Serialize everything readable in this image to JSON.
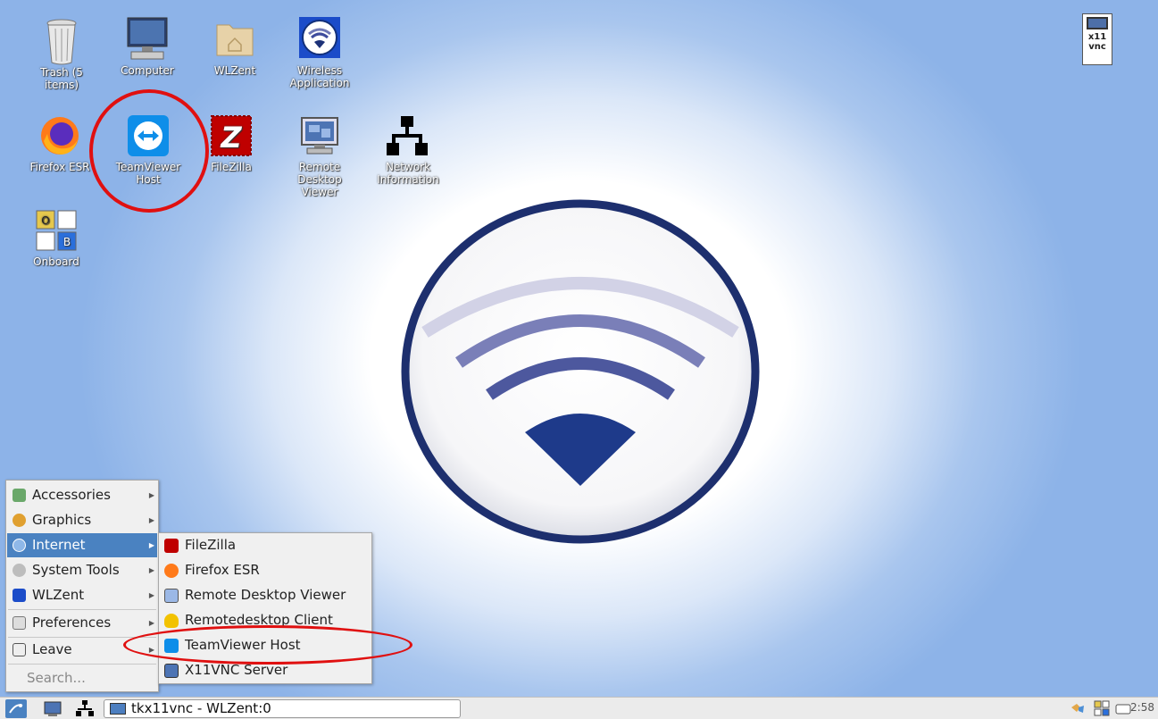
{
  "desktop": {
    "icons": [
      {
        "label": "Trash (5 items)",
        "name": "trash-icon"
      },
      {
        "label": "Computer",
        "name": "computer-icon"
      },
      {
        "label": "WLZent",
        "name": "home-folder-icon"
      },
      {
        "label": "Wireless Application",
        "name": "wireless-icon"
      },
      {
        "label": "Firefox ESR",
        "name": "firefox-icon"
      },
      {
        "label": "TeamViewer Host",
        "name": "teamviewer-icon"
      },
      {
        "label": "FileZilla",
        "name": "filezilla-icon"
      },
      {
        "label": "Remote Desktop Viewer",
        "name": "remote-desktop-icon"
      },
      {
        "label": "Network Information",
        "name": "network-icon"
      },
      {
        "label": "Onboard",
        "name": "keyboard-icon"
      }
    ],
    "vnc_label": "x11\nvnc"
  },
  "menu": {
    "items": [
      {
        "label": "Accessories",
        "icon": "accessories-icon"
      },
      {
        "label": "Graphics",
        "icon": "graphics-icon"
      },
      {
        "label": "Internet",
        "icon": "internet-icon"
      },
      {
        "label": "System Tools",
        "icon": "gear-icon"
      },
      {
        "label": "WLZent",
        "icon": "wlzent-icon"
      },
      {
        "label": "Preferences",
        "icon": "preferences-icon"
      },
      {
        "label": "Leave",
        "icon": "leave-icon"
      }
    ],
    "active_item": "Internet",
    "search_placeholder": "Search..."
  },
  "submenu": {
    "items": [
      {
        "label": "FileZilla",
        "icon": "filezilla-icon"
      },
      {
        "label": "Firefox ESR",
        "icon": "firefox-icon"
      },
      {
        "label": "Remote Desktop Viewer",
        "icon": "remote-desktop-icon"
      },
      {
        "label": "Remotedesktop Client",
        "icon": "tux-icon"
      },
      {
        "label": "TeamViewer Host",
        "icon": "teamviewer-icon"
      },
      {
        "label": "X11VNC Server",
        "icon": "monitor-icon"
      }
    ]
  },
  "taskbar": {
    "task_title": "tkx11vnc - WLZent:0",
    "clock": "2:58"
  },
  "colors": {
    "accent": "#4a82c1",
    "annotation": "#e01010",
    "logo_blue": "#1d3278"
  }
}
